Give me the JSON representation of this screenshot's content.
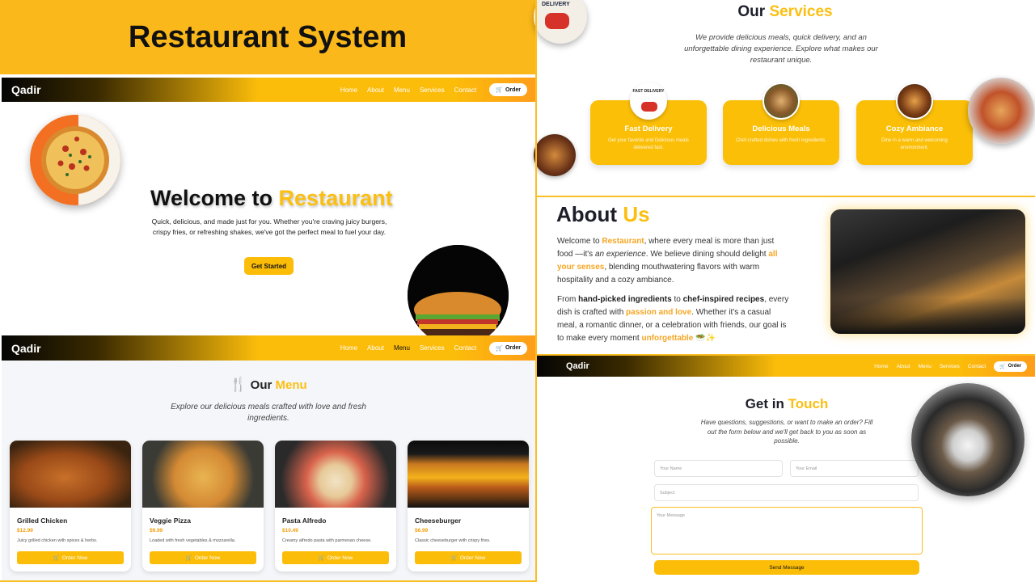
{
  "banner": {
    "title": "Restaurant System"
  },
  "nav": {
    "brand": "Qadir",
    "links": [
      "Home",
      "About",
      "Menu",
      "Services",
      "Contact"
    ],
    "order": "Order"
  },
  "hero": {
    "title_a": "Welcome to",
    "title_b": "Restaurant",
    "description": "Quick, delicious, and made just for you. Whether you're craving juicy burgers, crispy fries, or refreshing shakes, we've got the perfect meal to fuel your day.",
    "cta": "Get Started"
  },
  "menu": {
    "title_a": "Our",
    "title_b": "Menu",
    "subtitle": "Explore our delicious meals crafted with love and fresh ingredients.",
    "order_label": "Order Now",
    "items": [
      {
        "name": "Grilled Chicken",
        "price": "$12.99",
        "desc": "Juicy grilled chicken with spices & herbs."
      },
      {
        "name": "Veggie Pizza",
        "price": "$9.99",
        "desc": "Loaded with fresh vegetables & mozzarella."
      },
      {
        "name": "Pasta Alfredo",
        "price": "$10.49",
        "desc": "Creamy alfredo pasta with parmesan cheese."
      },
      {
        "name": "Cheeseburger",
        "price": "$6.99",
        "desc": "Classic cheeseburger with crispy fries."
      }
    ]
  },
  "services": {
    "title_a": "Our",
    "title_b": "Services",
    "subtitle": "We provide delicious meals, quick delivery, and an unforgettable dining experience. Explore what makes our restaurant unique.",
    "delivery_badge": "DELIVERY",
    "fast_badge": "FAST DELIVERY",
    "items": [
      {
        "title": "Fast Delivery",
        "desc": "Get your favorite and Delicious meals delivered fast."
      },
      {
        "title": "Delicious Meals",
        "desc": "Chef-crafted dishes with fresh ingredients."
      },
      {
        "title": "Cozy Ambiance",
        "desc": "Dine in a warm and welcoming environment."
      }
    ]
  },
  "about": {
    "title_a": "About",
    "title_b": "Us",
    "p1": {
      "a": "Welcome to ",
      "b": "Restaurant",
      "c": ", where every meal is more than just food —it's ",
      "d": "an experience",
      "e": ". We believe dining should delight ",
      "f": "all your senses",
      "g": ", blending mouthwatering flavors with warm hospitality and a cozy ambiance."
    },
    "p2": {
      "a": "From ",
      "b": "hand-picked ingredients",
      "c": " to ",
      "d": "chef-inspired recipes",
      "e": ", every dish is crafted with ",
      "f": "passion and love",
      "g": ". Whether it's a casual meal, a romantic dinner, or a celebration with friends, our goal is to make every moment ",
      "h": "unforgettable",
      "i": " 🥗✨"
    }
  },
  "contact": {
    "title_a": "Get in",
    "title_b": "Touch",
    "subtitle": "Have questions, suggestions, or want to make an order? Fill out the form below and we'll get back to you as soon as possible.",
    "name_ph": "Your Name",
    "email_ph": "Your Email",
    "subject_ph": "Subject",
    "message_ph": "Your Message",
    "send": "Send Message"
  }
}
